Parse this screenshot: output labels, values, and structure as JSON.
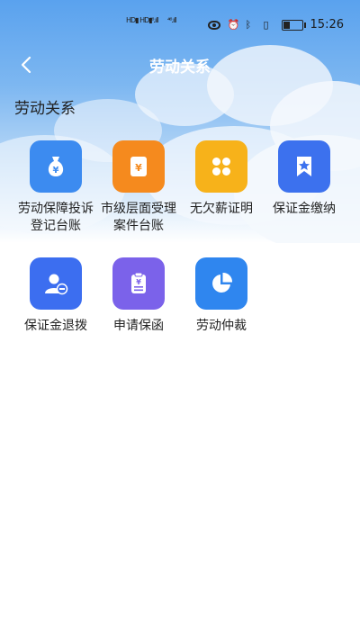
{
  "status_bar": {
    "signal_1": "HD▮ HD▮",
    "signal_2": "⁴⁶.ıll",
    "signal_3": "⁴⁶.ıll",
    "time": "15:26",
    "battery_level": 0.35
  },
  "nav": {
    "back_icon": "chevron-left-icon",
    "title": "劳动关系"
  },
  "section": {
    "title": "劳动关系"
  },
  "items": [
    {
      "label": "劳动保障投诉登记台账",
      "icon": "money-bag-icon",
      "color": "#3c8bf0"
    },
    {
      "label": "市级层面受理案件台账",
      "icon": "yen-document-icon",
      "color": "#f58a1e"
    },
    {
      "label": "无欠薪证明",
      "icon": "clover-icon",
      "color": "#f7b21a"
    },
    {
      "label": "保证金缴纳",
      "icon": "bookmark-star-icon",
      "color": "#3c71ee"
    },
    {
      "label": "保证金退拨",
      "icon": "user-minus-icon",
      "color": "#3c6ef0"
    },
    {
      "label": "申请保函",
      "icon": "clipboard-yen-icon",
      "color": "#7b62ea"
    },
    {
      "label": "劳动仲裁",
      "icon": "pie-chart-icon",
      "color": "#2f86ef"
    }
  ]
}
